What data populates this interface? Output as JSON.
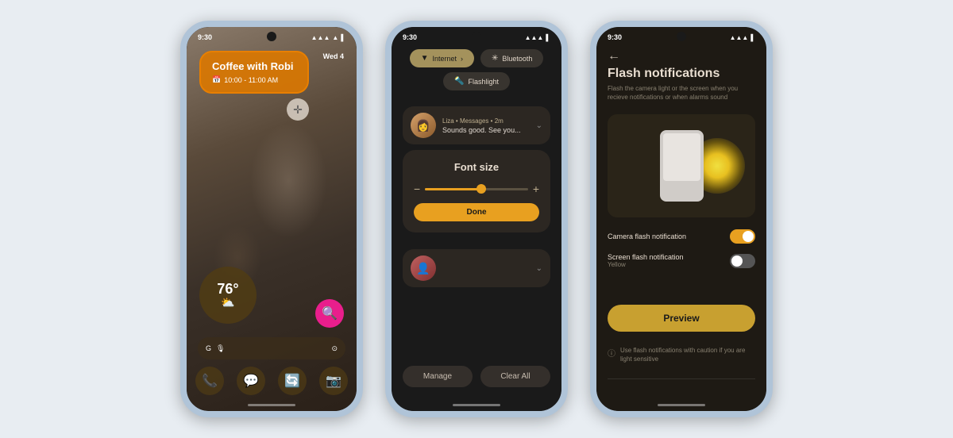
{
  "phone1": {
    "status_time": "9:30",
    "calendar": {
      "title": "Coffee with Robi",
      "time": "10:00 - 11:00 AM"
    },
    "date_badge": "Wed 4",
    "weather": {
      "temp": "76°",
      "icon": "⛅"
    },
    "search_placeholder": "G",
    "dock_icons": [
      "📞",
      "💬",
      "🔄",
      "📷"
    ]
  },
  "phone2": {
    "status_time": "9:30",
    "tiles": {
      "internet": "Internet",
      "bluetooth": "Bluetooth",
      "flashlight": "Flashlight"
    },
    "notification": {
      "name": "Liza",
      "app": "Messages",
      "time": "2m",
      "text": "Sounds good. See you..."
    },
    "font_size": {
      "title": "Font size",
      "done_label": "Done"
    },
    "manage_label": "Manage",
    "clear_all_label": "Clear All"
  },
  "phone3": {
    "status_time": "9:30",
    "title": "Flash notifications",
    "subtitle": "Flash the camera light or the screen when you recieve notifications or when alarms sound",
    "camera_flash_label": "Camera flash notification",
    "screen_flash_label": "Screen flash notification",
    "screen_flash_sublabel": "Yellow",
    "preview_label": "Preview",
    "caution_text": "Use flash notifications with caution if you are light sensitive"
  }
}
